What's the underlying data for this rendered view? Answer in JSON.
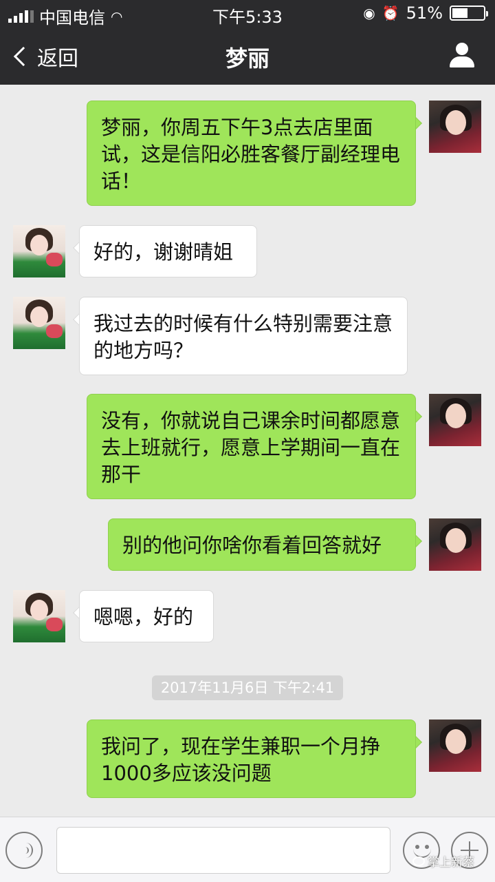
{
  "status_bar": {
    "carrier": "中国电信",
    "time": "下午5:33",
    "battery": "51%",
    "battery_level": 0.51
  },
  "nav": {
    "back_label": "返回",
    "title": "梦丽"
  },
  "messages": [
    {
      "sender": "self",
      "text": "梦丽，你周五下午3点去店里面试，这是信阳必胜客餐厅副经理电话！"
    },
    {
      "sender": "other",
      "text": "好的，谢谢晴姐"
    },
    {
      "sender": "other",
      "text": "我过去的时候有什么特别需要注意的地方吗？"
    },
    {
      "sender": "self",
      "text": "没有，你就说自己课余时间都愿意去上班就行，愿意上学期间一直在那干"
    },
    {
      "sender": "self",
      "text": "别的他问你啥你看着回答就好"
    },
    {
      "sender": "other",
      "text": "嗯嗯，好的"
    },
    {
      "sender": "self",
      "text": "我问了，现在学生兼职一个月挣1000多应该没问题"
    }
  ],
  "timestamp": "2017年11月6日 下午2:41",
  "input_bar": {
    "placeholder": ""
  },
  "watermark": "掌上新蔡",
  "colors": {
    "self_bubble": "#9fe55a",
    "other_bubble": "#ffffff",
    "nav_bg": "#2b2b2d",
    "chat_bg": "#ebebeb"
  }
}
